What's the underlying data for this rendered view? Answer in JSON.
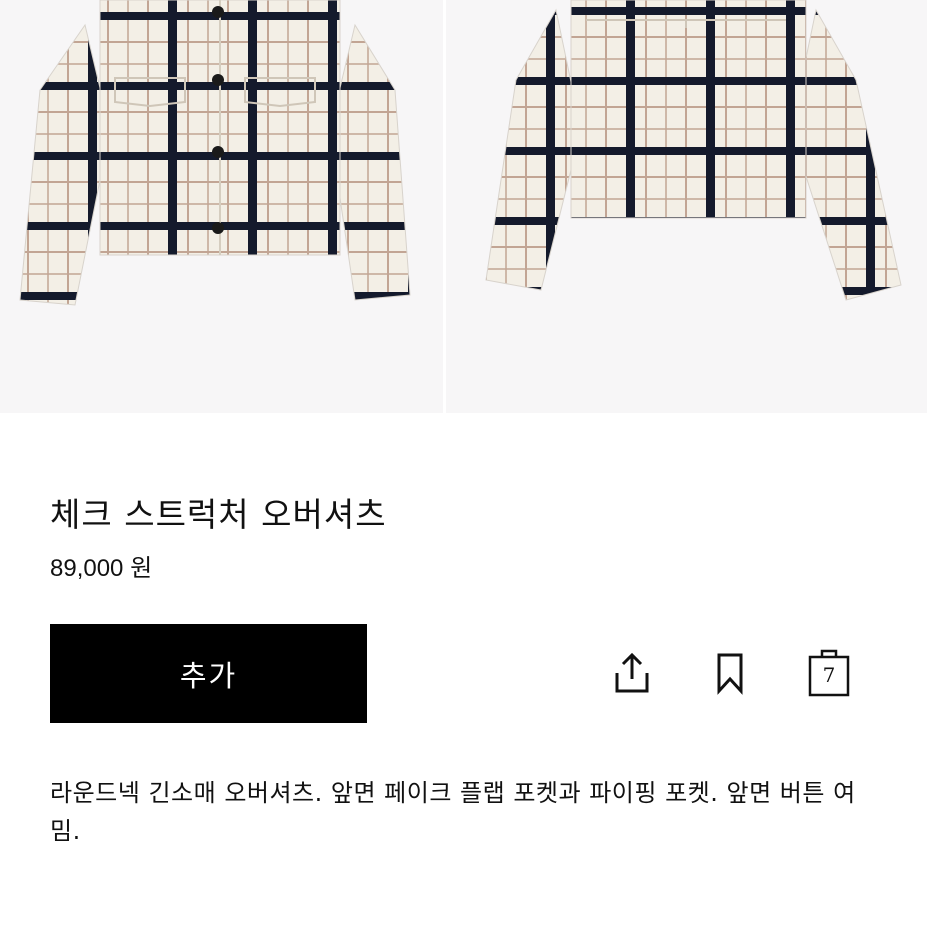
{
  "product": {
    "title": "체크 스트럭처 오버셔츠",
    "price": "89,000 원",
    "add_label": "추가",
    "bag_count": "7",
    "description": "라운드넥 긴소매 오버셔츠. 앞면 페이크 플랩 포켓과 파이핑 포켓. 앞면 버튼 여밈."
  },
  "icons": {
    "share": "share-icon",
    "bookmark": "bookmark-icon",
    "bag": "shopping-bag-icon"
  },
  "colors": {
    "accent": "#000000",
    "background": "#ffffff",
    "photo_background": "#f7f6f7",
    "fabric": "#f3efe6",
    "check_dark": "#141a2c",
    "check_light": "#b99a8a"
  }
}
